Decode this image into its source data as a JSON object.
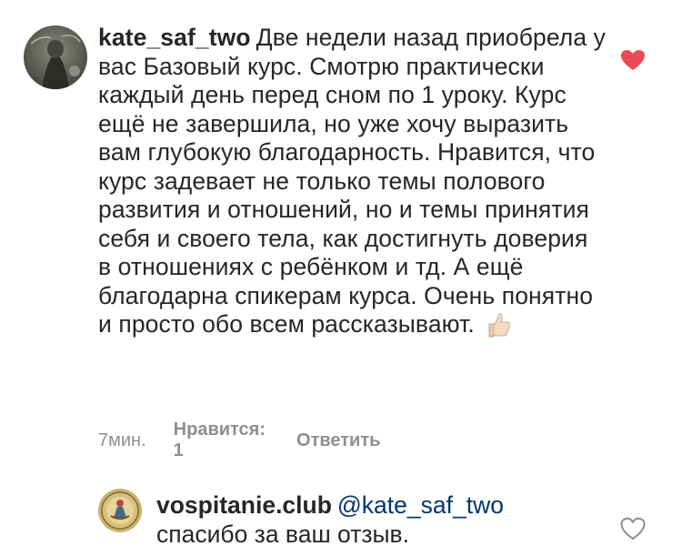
{
  "comment": {
    "username": "kate_saf_two",
    "text": "Две недели назад приобрела у вас Базовый курс. Смотрю практически каждый день перед сном по 1 уроку. Курс ещё не завершила, но уже хочу выразить вам глубокую благодарность. Нравится, что курс задевает не только темы полового развития и отношений, но и темы принятия себя и своего тела, как достигнуть доверия в отношениях с ребёнком и тд. А ещё благодарна спикерам курса. Очень понятно и просто обо всем рассказывают.",
    "emoji": "👍🏻",
    "time": "7мин.",
    "likes_label": "Нравится: 1",
    "reply_label": "Ответить",
    "liked": true
  },
  "reply": {
    "username": "vospitanie.club",
    "mention": "@kate_saf_two",
    "text": "спасибо за ваш отзыв.",
    "liked": false
  },
  "colors": {
    "heart_red": "#ed4956",
    "text_dark": "#262626",
    "meta_gray": "#8e8e8e",
    "mention_blue": "#00376b"
  }
}
